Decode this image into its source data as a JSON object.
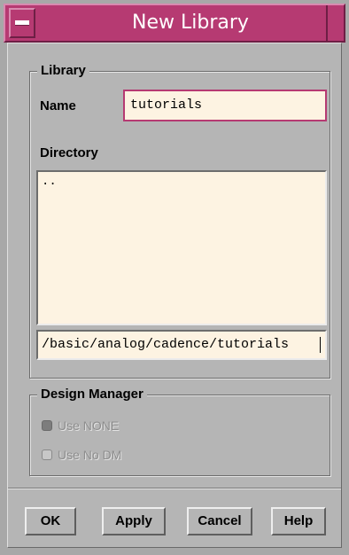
{
  "window": {
    "title": "New Library",
    "menu_icon": "window-menu-icon"
  },
  "library_group": {
    "label": "Library",
    "name_label": "Name",
    "name_value": "tutorials",
    "directory_label": "Directory",
    "directory_list": "..",
    "directory_path": "/basic/analog/cadence/tutorials"
  },
  "design_manager": {
    "label": "Design Manager",
    "options": [
      {
        "label": "Use  NONE",
        "selected": true
      },
      {
        "label": "Use No DM",
        "selected": false
      }
    ]
  },
  "buttons": {
    "ok": "OK",
    "apply": "Apply",
    "cancel": "Cancel",
    "help": "Help"
  },
  "colors": {
    "title_bar": "#b63a72",
    "panel": "#b5b5b5",
    "field": "#fdf3e2"
  }
}
